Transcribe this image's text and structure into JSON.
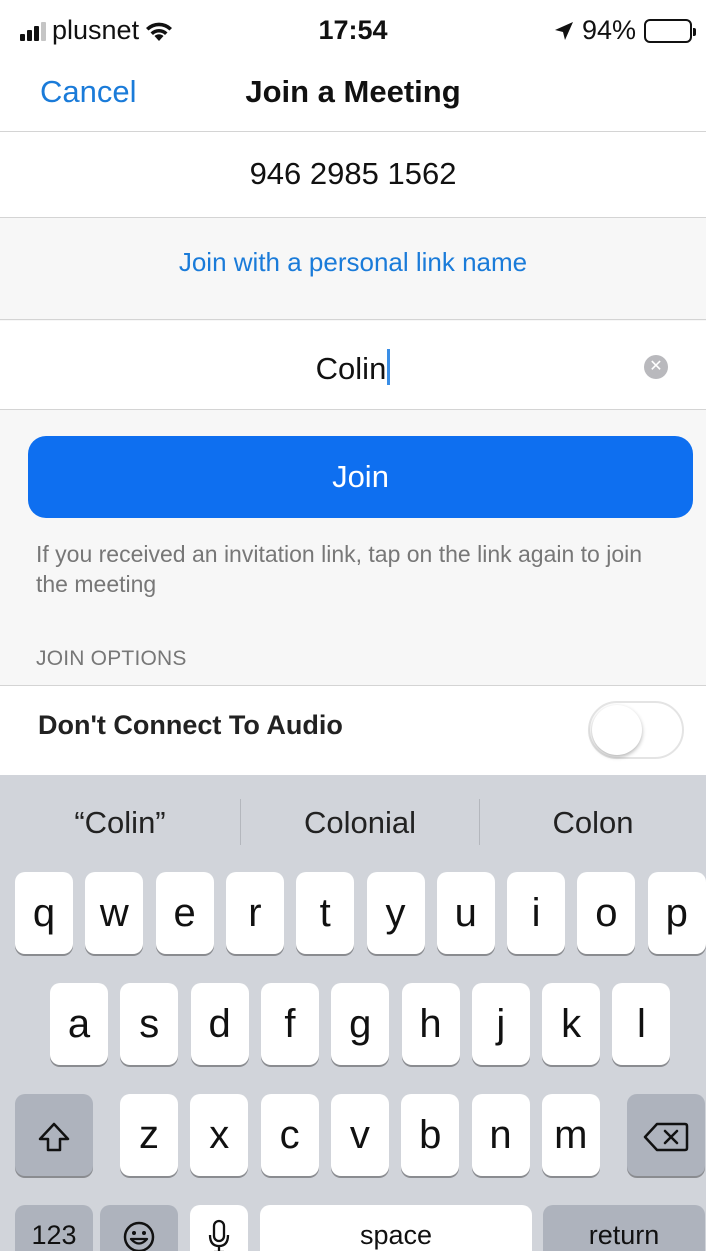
{
  "status_bar": {
    "carrier": "plusnet",
    "time": "17:54",
    "battery": "94%",
    "battery_level": 0.94
  },
  "nav": {
    "cancel_label": "Cancel",
    "title": "Join a Meeting"
  },
  "form": {
    "meeting_id": "946 2985 1562",
    "personal_link_label": "Join with a personal link name",
    "name_value": "Colin",
    "join_label": "Join",
    "hint": "If you received an invitation link, tap on the link again to join the meeting",
    "section_header": "JOIN OPTIONS",
    "audio_option_label": "Don't Connect To Audio",
    "audio_option_on": false
  },
  "keyboard": {
    "suggestions": [
      "“Colin”",
      "Colonial",
      "Colon"
    ],
    "row1": [
      "q",
      "w",
      "e",
      "r",
      "t",
      "y",
      "u",
      "i",
      "o",
      "p"
    ],
    "row2": [
      "a",
      "s",
      "d",
      "f",
      "g",
      "h",
      "j",
      "k",
      "l"
    ],
    "row3": [
      "z",
      "x",
      "c",
      "v",
      "b",
      "n",
      "m"
    ],
    "numbers_label": "123",
    "space_label": "space",
    "return_label": "return"
  }
}
